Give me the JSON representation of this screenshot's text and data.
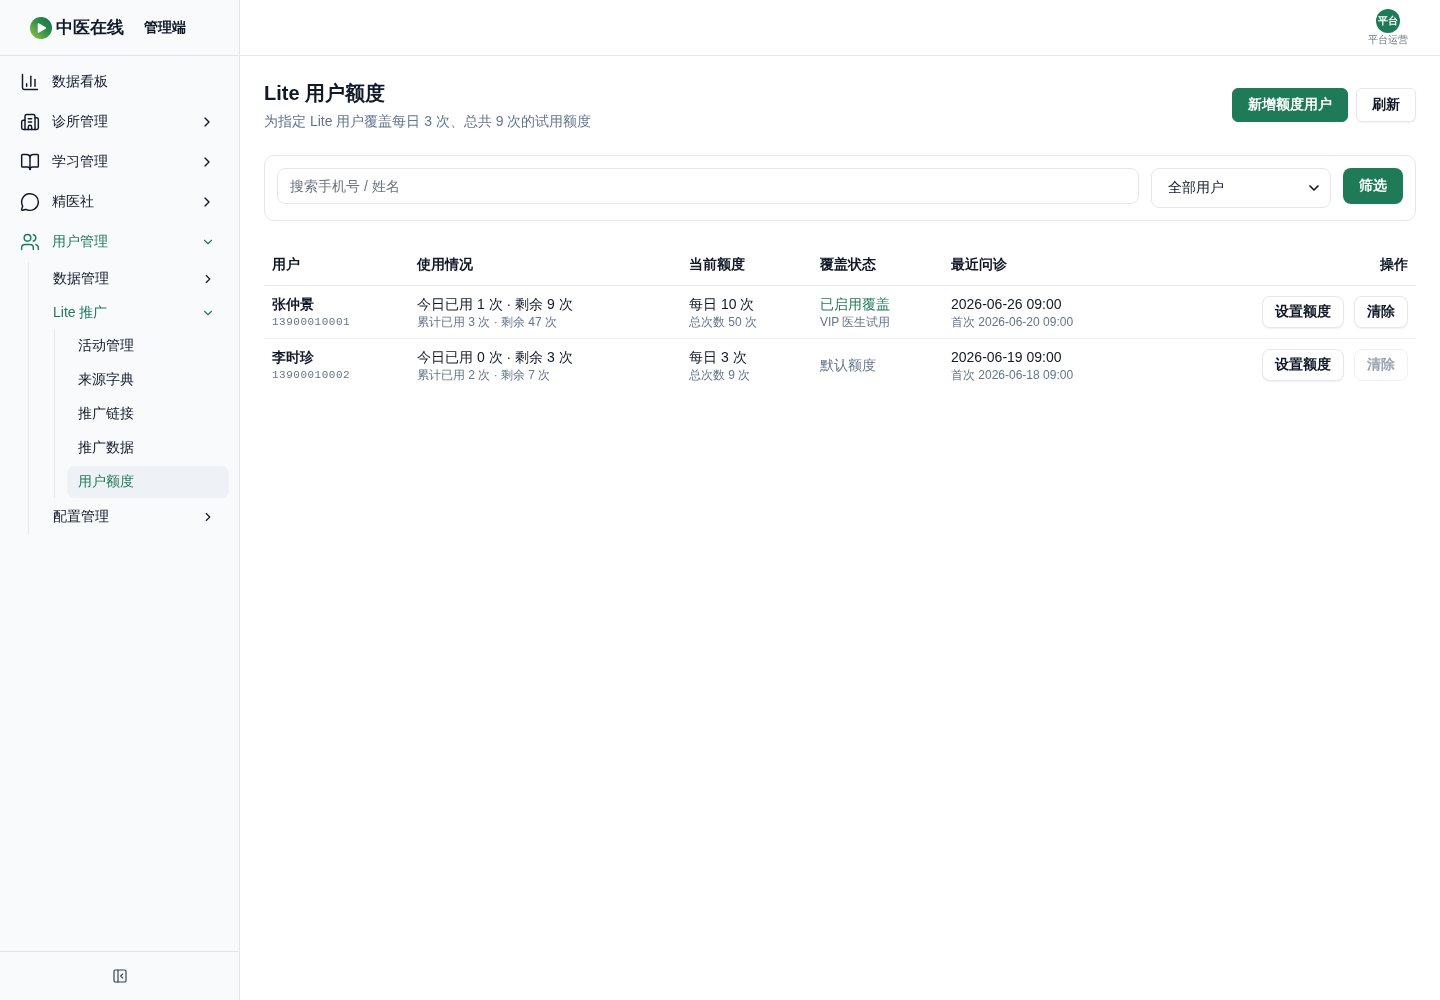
{
  "app": {
    "name": "中医在线",
    "suffix": "管理端"
  },
  "sidebar": {
    "items": [
      {
        "label": "数据看板",
        "selected": false
      },
      {
        "label": "诊所管理",
        "expanded": false
      },
      {
        "label": "学习管理",
        "expanded": false
      },
      {
        "label": "精医社",
        "expanded": false
      },
      {
        "label": "用户管理",
        "expanded": true,
        "children": [
          {
            "label": "数据管理",
            "expanded": false
          },
          {
            "label": "Lite 推广",
            "expanded": true,
            "children": [
              {
                "label": "活动管理",
                "selected": false
              },
              {
                "label": "来源字典",
                "selected": false
              },
              {
                "label": "推广链接",
                "selected": false
              },
              {
                "label": "推广数据",
                "selected": false
              },
              {
                "label": "用户额度",
                "selected": true
              }
            ]
          },
          {
            "label": "配置管理",
            "expanded": false
          }
        ]
      }
    ]
  },
  "user": {
    "avatar": "平台",
    "role": "平台运营"
  },
  "page": {
    "title": "Lite 用户额度",
    "subtitle": "为指定 Lite 用户覆盖每日 3 次、总共 9 次的试用额度",
    "actions": [
      {
        "label": "新增额度用户",
        "kind": "primary"
      },
      {
        "label": "刷新",
        "kind": "secondary"
      }
    ]
  },
  "filter": {
    "search": {
      "placeholder": "搜索手机号 / 姓名"
    },
    "select": {
      "value": "全部用户"
    },
    "button": "筛选"
  },
  "table": {
    "columns": [
      "用户",
      "使用情况",
      "当前额度",
      "覆盖状态",
      "最近问诊",
      "操作"
    ],
    "rows": [
      {
        "name": "张仲景",
        "phone": "13900010001",
        "usage_today": "今日已用 1 次 · 剩余 9 次",
        "usage_total": "累计已用 3 次 · 剩余 47 次",
        "quota_daily": "每日 10 次",
        "quota_total": "总次数 50 次",
        "coverage": {
          "label": "已启用覆盖",
          "overridden": true,
          "note": "VIP 医生试用"
        },
        "last_visit": "2026-06-26 09:00",
        "first_visit": "首次 2026-06-20 09:00",
        "actions": [
          {
            "label": "设置额度",
            "disabled": false
          },
          {
            "label": "清除",
            "disabled": false
          }
        ]
      },
      {
        "name": "李时珍",
        "phone": "13900010002",
        "usage_today": "今日已用 0 次 · 剩余 3 次",
        "usage_total": "累计已用 2 次 · 剩余 7 次",
        "quota_daily": "每日 3 次",
        "quota_total": "总次数 9 次",
        "coverage": {
          "label": "默认额度",
          "overridden": false
        },
        "last_visit": "2026-06-19 09:00",
        "first_visit": "首次 2026-06-18 09:00",
        "actions": [
          {
            "label": "设置额度",
            "disabled": false
          },
          {
            "label": "清除",
            "disabled": true
          }
        ]
      }
    ]
  }
}
